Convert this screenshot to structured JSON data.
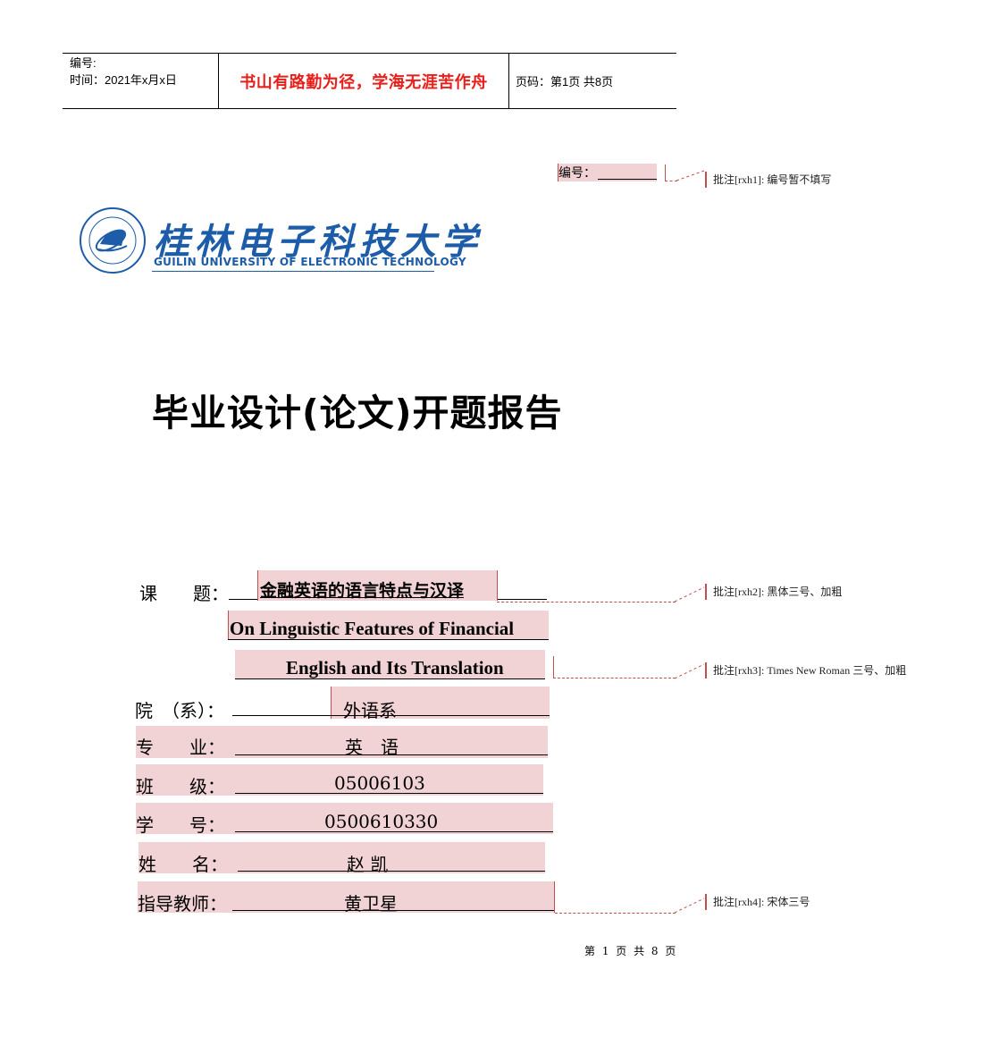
{
  "header": {
    "serial_label": "编号:",
    "date_label": "时间：2021年x月x日",
    "motto": "书山有路勤为径，学海无涯苦作舟",
    "page_info": "页码：第1页  共8页"
  },
  "serial_field": {
    "label": "编号：",
    "value": ""
  },
  "comments": [
    {
      "id": "rxh1",
      "text": "批注[rxh1]:  编号暂不填写"
    },
    {
      "id": "rxh2",
      "text": "批注[rxh2]:  黑体三号、加粗"
    },
    {
      "id": "rxh3",
      "text": "批注[rxh3]:  Times New Roman  三号、加粗"
    },
    {
      "id": "rxh4",
      "text": "批注[rxh4]:  宋体三号"
    }
  ],
  "logo": {
    "name_cn": "桂林电子科技大学",
    "name_en": "GUILIN UNIVERSITY OF ELECTRONIC TECHNOLOGY",
    "emblem_icon": "university-emblem-icon"
  },
  "document_title": "毕业设计(论文)开题报告",
  "form": {
    "topic": {
      "label": "课　　题：",
      "value_cn": "金融英语的语言特点与汉译",
      "value_en_line1": "On Linguistic Features of Financial",
      "value_en_line2": "English and Its Translation"
    },
    "fields": [
      {
        "key": "department",
        "label": "院　（系）：",
        "value": "外语系"
      },
      {
        "key": "major",
        "label": "专　　业：",
        "value": "英　语"
      },
      {
        "key": "class",
        "label": "班　　级：",
        "value": "05006103"
      },
      {
        "key": "student_id",
        "label": "学　　号：",
        "value": "0500610330"
      },
      {
        "key": "name",
        "label": "姓　　名：",
        "value": "赵 凯"
      },
      {
        "key": "advisor",
        "label": "指导教师：",
        "value": "黄卫星"
      }
    ]
  },
  "footer": {
    "page_text": "第 1 页 共 8 页"
  },
  "colors": {
    "motto": "#e8201c",
    "highlight": "#f2d3d5",
    "comment_mark": "#c0504d",
    "logo_blue": "#1c5ca8"
  }
}
